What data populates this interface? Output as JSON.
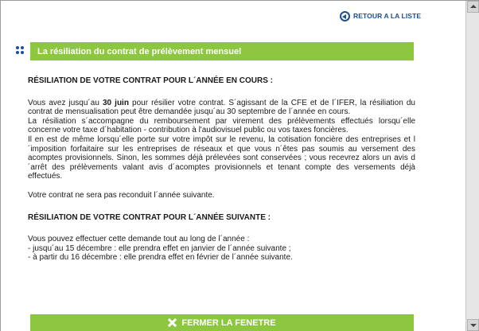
{
  "back_link": {
    "label": "RETOUR A LA LISTE",
    "icon": "back-arrow-circle-icon"
  },
  "title_bar": {
    "title": "La résiliation du contrat de prélèvement mensuel"
  },
  "section1": {
    "heading": "RÉSILIATION DE VOTRE CONTRAT POUR L´ANNÉE EN COURS :",
    "p1_before": "Vous avez jusqu´au ",
    "p1_bold": "30 juin",
    "p1_after": " pour résilier votre contrat. S´agissant de la CFE et de l´IFER, la résiliation du contrat de mensualisation peut être demandée jusqu´au 30 septembre de l´année en cours.",
    "p2": "La résiliation s´accompagne du remboursement par virement des prélèvements effectués lorsqu´elle concerne votre taxe d´habitation - contribution à l'audiovisuel public ou vos taxes foncières.",
    "p3": "Il en est de même lorsqu´elle porte sur votre impôt sur le revenu, la cotisation foncière des entreprises et l´imposition forfaitaire sur les entreprises de réseaux et que vous n´êtes pas soumis au versement des acomptes provisionnels. Sinon, les sommes déjà prélevées sont conservées ; vous recevrez alors un avis d´arrêt des prélèvements valant avis d´acomptes provisionnels et tenant compte des versements déjà effectués.",
    "p4": "Votre contrat ne sera pas reconduit l´année suivante."
  },
  "section2": {
    "heading": "RÉSILIATION DE VOTRE CONTRAT POUR L´ANNÉE SUIVANTE :",
    "p1": "Vous pouvez effectuer cette demande tout au long de l´année :",
    "l1": "- jusqu´au 15 décembre : elle prendra effet en janvier de l´année suivante ;",
    "l2": "- à partir du 16 décembre : elle prendra effet en février de l´année suivante."
  },
  "close_button": {
    "label": "FERMER LA FENETRE",
    "icon": "close-x-icon"
  },
  "colors": {
    "accent_green": "#8dc63f",
    "link_blue": "#1d4f91"
  }
}
